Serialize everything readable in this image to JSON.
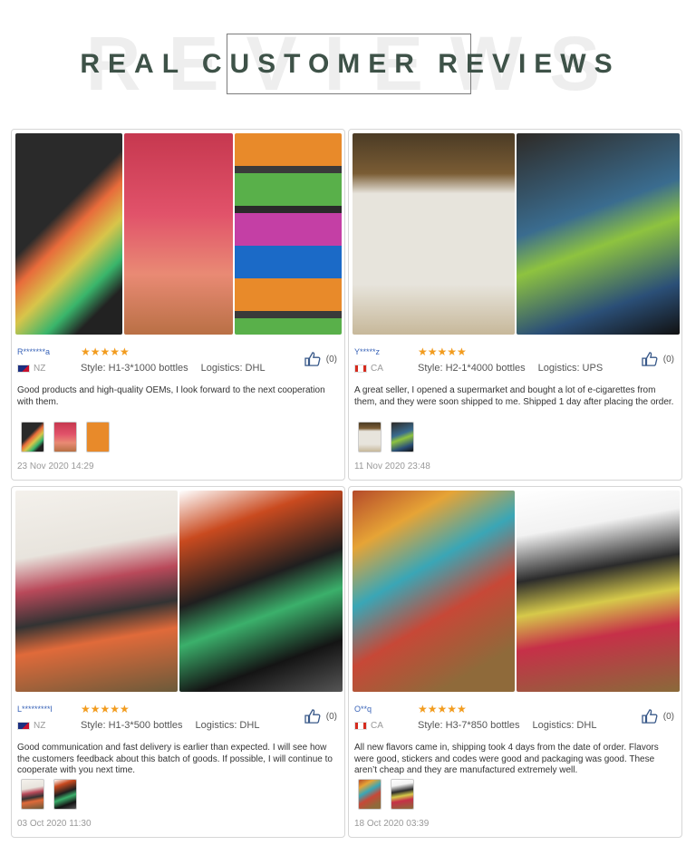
{
  "header": {
    "bg_word": "REVIEWS",
    "title": "REAL CUSTOMER REVIEWS"
  },
  "colors": {
    "title": "#3e5248",
    "stars": "#f29c1f",
    "user": "#3a64b8"
  },
  "reviews": [
    {
      "user": "R*******a",
      "country": "NZ",
      "stars": "★★★★★",
      "style": "Style: H1-3*1000 bottles",
      "logistics": "Logistics: DHL",
      "likes": "(0)",
      "text": "Good products and high-quality OEMs, I look forward to the next cooperation with them.",
      "date": "23 Nov 2020 14:29"
    },
    {
      "user": "Y*****z",
      "country": "CA",
      "stars": "★★★★★",
      "style": "Style: H2-1*4000 bottles",
      "logistics": "Logistics: UPS",
      "likes": "(0)",
      "text": "A great seller, I opened a supermarket and bought a lot of e-cigarettes from them, and they were soon shipped to me. Shipped 1 day after placing the order.",
      "date": "11 Nov 2020 23:48"
    },
    {
      "user": "L*********l",
      "country": "NZ",
      "stars": "★★★★★",
      "style": "Style: H1-3*500 bottles",
      "logistics": "Logistics: DHL",
      "likes": "(0)",
      "text": "Good communication and fast delivery is earlier than expected. I will see how the customers feedback about this batch of goods. If possible, I will continue to cooperate with you next time.",
      "date": "03 Oct 2020 11:30"
    },
    {
      "user": "O**q",
      "country": "CA",
      "stars": "★★★★★",
      "style": "Style: H3-7*850 bottles",
      "logistics": "Logistics: DHL",
      "likes": "(0)",
      "text": "All new flavors came in, shipping took 4 days from the date of order. Flavors were good, stickers and codes were good and packaging was good. These aren’t cheap and they are manufactured extremely well.",
      "date": "18 Oct 2020 03:39"
    }
  ]
}
